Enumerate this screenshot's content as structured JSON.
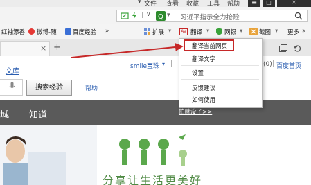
{
  "menu": {
    "file": "文件",
    "view": "查看",
    "favorites": "收藏",
    "tools": "工具",
    "help": "帮助"
  },
  "address": {
    "search_text": "习近平指示全力抢险"
  },
  "bookmarks": {
    "item1": "红袖添香",
    "item2": "微博-随",
    "item3": "百度经验",
    "more_bm": "»",
    "extensions": "扩展",
    "translate": "翻译",
    "netsilver": "网银",
    "screenshot": "截图",
    "more": "更多"
  },
  "tab": {
    "close": "×",
    "new": "+"
  },
  "page": {
    "wenku": "文库",
    "search_button": "搜索经验",
    "help": "帮助",
    "user": "smile宝珠",
    "count": "(0)",
    "baidu_home": "百度首页",
    "nav1": "城",
    "nav2": "知道",
    "tip_text": "拍就没了>>",
    "slogan": "分享让生活更美好"
  },
  "dropdown": {
    "items": [
      "翻译当前网页",
      "翻译文字",
      "设置",
      "反馈建议",
      "如何使用"
    ]
  },
  "colors": {
    "accent_red": "#c62828",
    "nav_dark": "#5a5a5a",
    "logo_green": "#4f8a44"
  }
}
